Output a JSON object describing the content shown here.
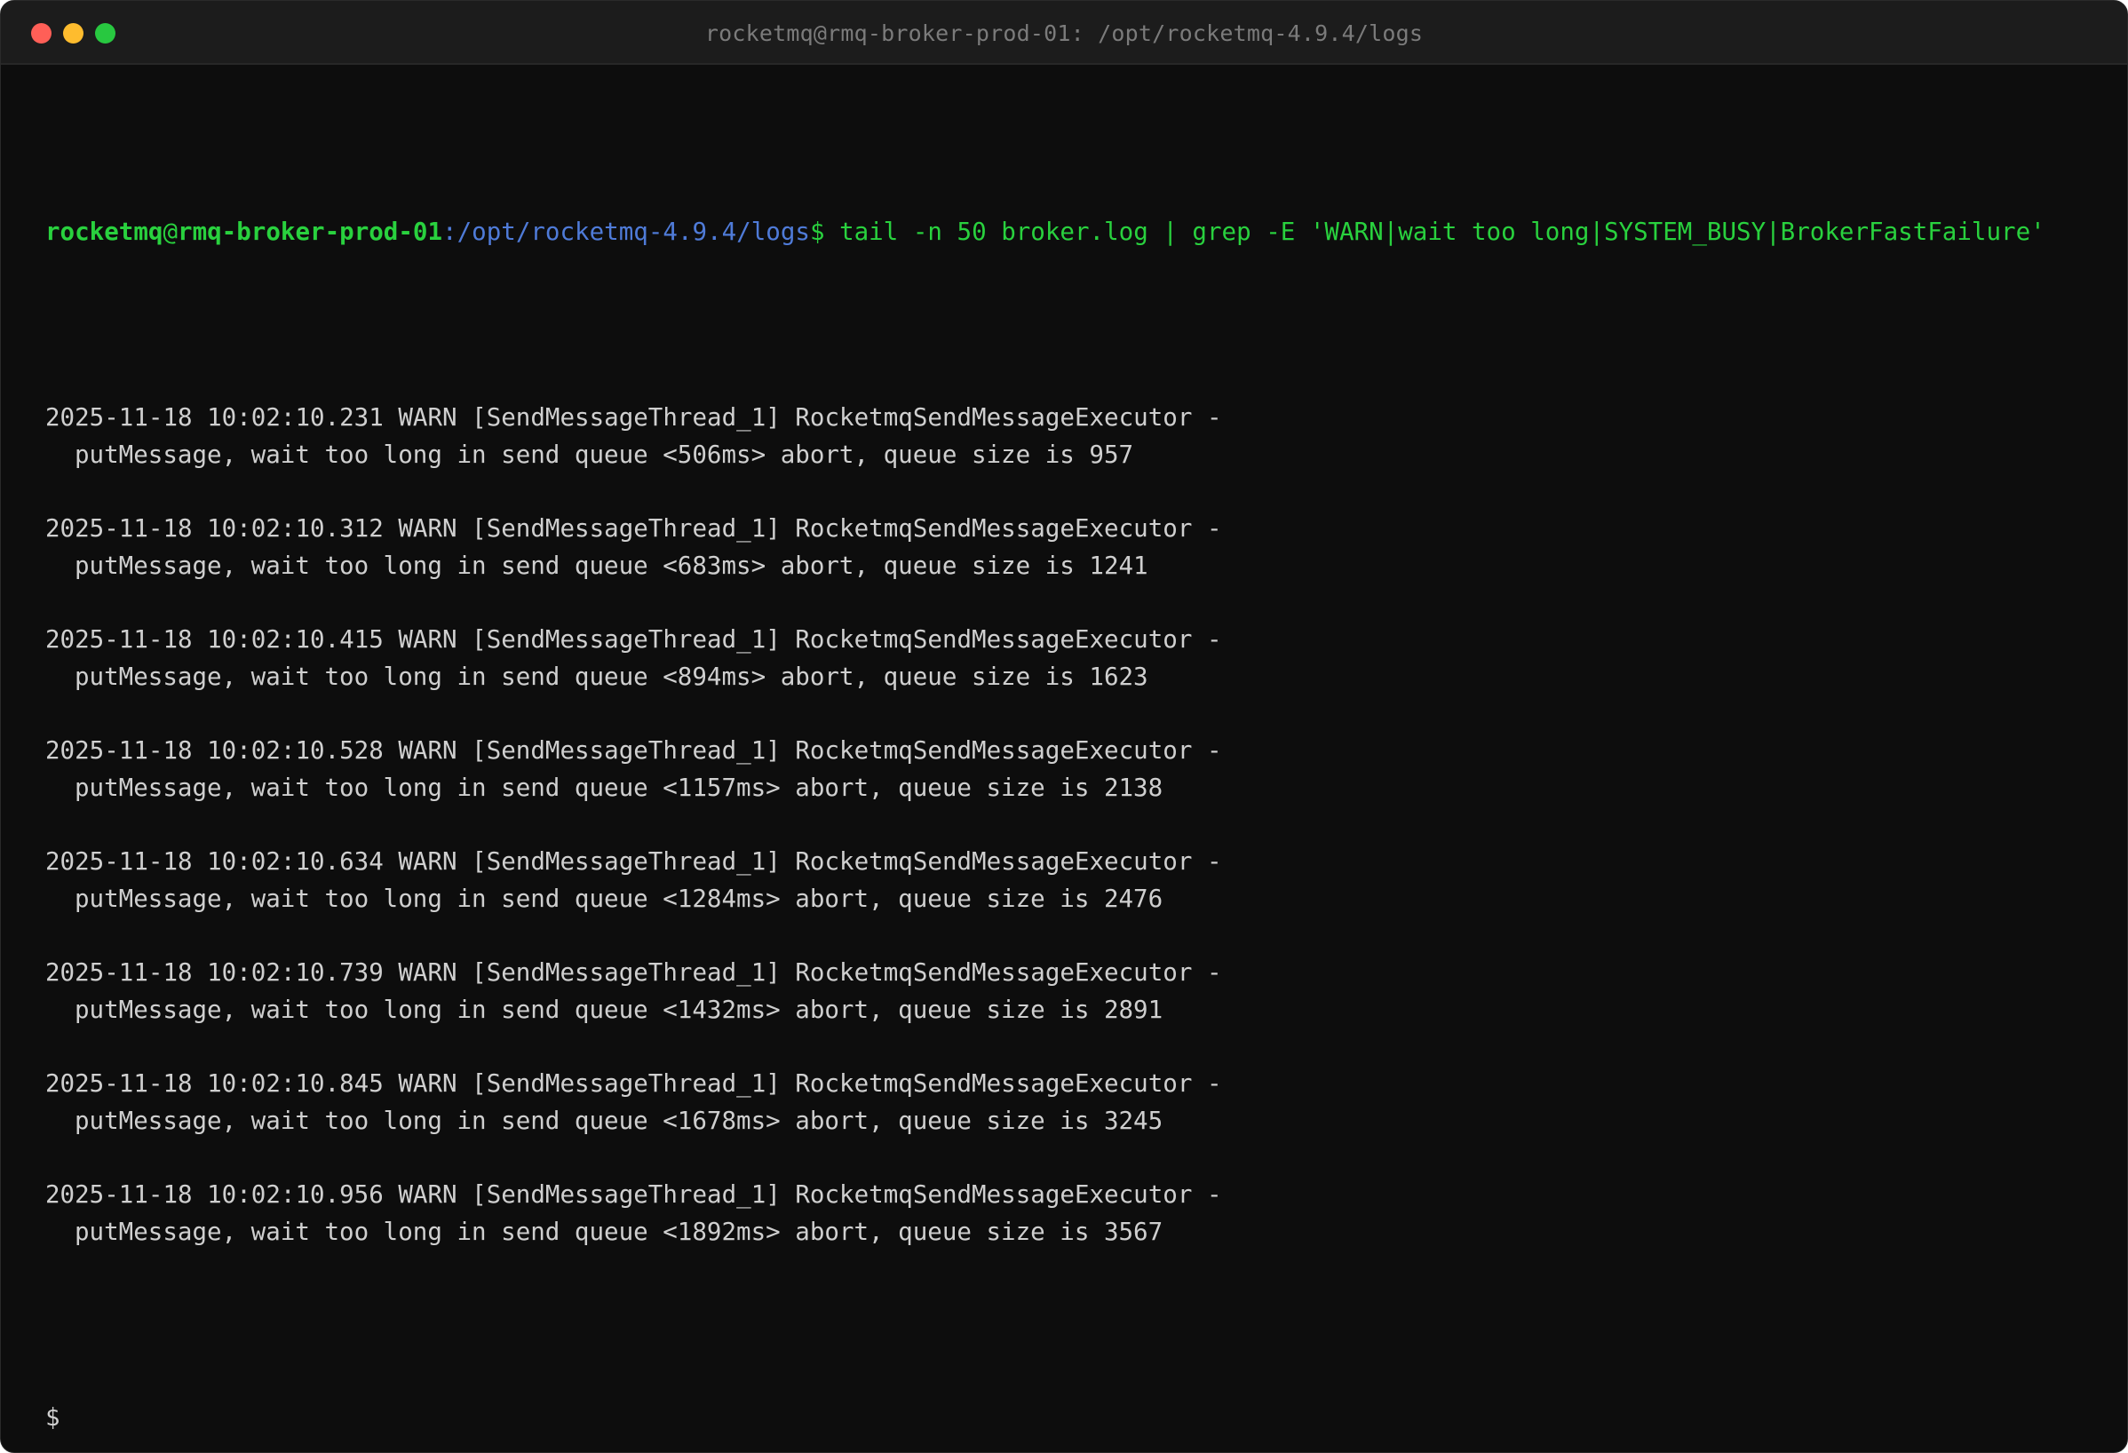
{
  "window": {
    "title": "rocketmq@rmq-broker-prod-01: /opt/rocketmq-4.9.4/logs",
    "traffic_lights": {
      "close_color": "#ff5f57",
      "minimize_color": "#febc2e",
      "maximize_color": "#28c840"
    }
  },
  "colors": {
    "background": "#0d0d0d",
    "prompt_green": "#29d13e",
    "path_blue": "#4f7bd8",
    "text": "#cfcfcf"
  },
  "prompt": {
    "user": "rocketmq",
    "at": "@",
    "host": "rmq-broker-prod-01",
    "colon": ":",
    "path": "/opt/rocketmq-4.9.4/logs",
    "dollar": "$",
    "command": " tail -n 50 broker.log | grep -E 'WARN|wait too long|SYSTEM_BUSY|BrokerFastFailure'"
  },
  "log_entries": [
    {
      "header": "2025-11-18 10:02:10.231 WARN [SendMessageThread_1] RocketmqSendMessageExecutor -",
      "message": "putMessage, wait too long in send queue <506ms> abort, queue size is 957"
    },
    {
      "header": "2025-11-18 10:02:10.312 WARN [SendMessageThread_1] RocketmqSendMessageExecutor -",
      "message": "putMessage, wait too long in send queue <683ms> abort, queue size is 1241"
    },
    {
      "header": "2025-11-18 10:02:10.415 WARN [SendMessageThread_1] RocketmqSendMessageExecutor -",
      "message": "putMessage, wait too long in send queue <894ms> abort, queue size is 1623"
    },
    {
      "header": "2025-11-18 10:02:10.528 WARN [SendMessageThread_1] RocketmqSendMessageExecutor -",
      "message": "putMessage, wait too long in send queue <1157ms> abort, queue size is 2138"
    },
    {
      "header": "2025-11-18 10:02:10.634 WARN [SendMessageThread_1] RocketmqSendMessageExecutor -",
      "message": "putMessage, wait too long in send queue <1284ms> abort, queue size is 2476"
    },
    {
      "header": "2025-11-18 10:02:10.739 WARN [SendMessageThread_1] RocketmqSendMessageExecutor -",
      "message": "putMessage, wait too long in send queue <1432ms> abort, queue size is 2891"
    },
    {
      "header": "2025-11-18 10:02:10.845 WARN [SendMessageThread_1] RocketmqSendMessageExecutor -",
      "message": "putMessage, wait too long in send queue <1678ms> abort, queue size is 3245"
    },
    {
      "header": "2025-11-18 10:02:10.956 WARN [SendMessageThread_1] RocketmqSendMessageExecutor -",
      "message": "putMessage, wait too long in send queue <1892ms> abort, queue size is 3567"
    }
  ],
  "final_prompt": "$"
}
